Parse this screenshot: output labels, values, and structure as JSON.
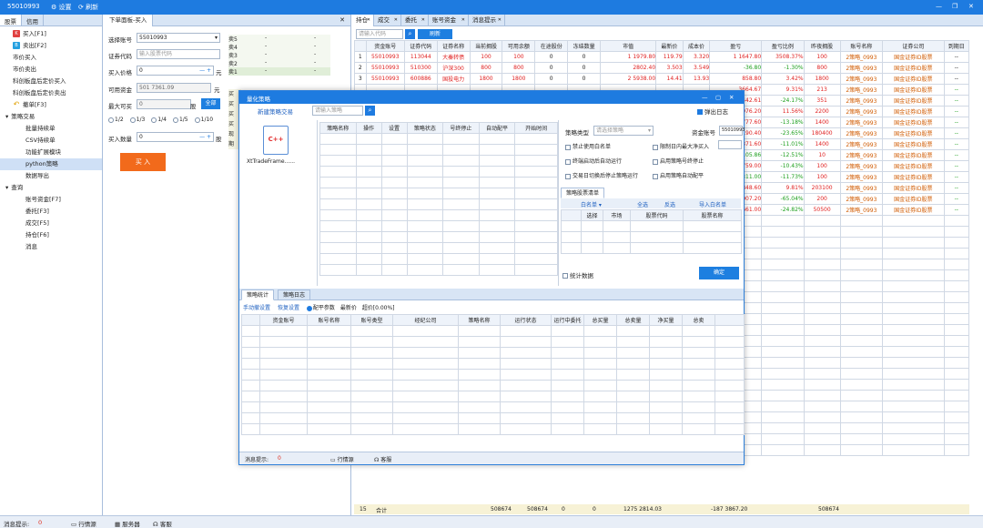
{
  "titlebar": {
    "account": "55010993",
    "settings": "设置",
    "refresh": "刷新"
  },
  "left_tabs": [
    "股票",
    "信用"
  ],
  "menu": [
    {
      "label": "买入[F1]",
      "icon": "K",
      "color": "#e04040",
      "indent": 14,
      "sel": false
    },
    {
      "label": "卖出[F2]",
      "icon": "B",
      "color": "#24a0e0",
      "indent": 14,
      "sel": false
    },
    {
      "label": "市价买入",
      "icon": "",
      "color": "",
      "indent": 14,
      "sel": false
    },
    {
      "label": "市价卖出",
      "icon": "",
      "color": "",
      "indent": 14,
      "sel": false
    },
    {
      "label": "科创板盘后定价买入",
      "icon": "",
      "color": "",
      "indent": 14,
      "sel": false
    },
    {
      "label": "科创板盘后定价卖出",
      "icon": "",
      "color": "",
      "indent": 14,
      "sel": false
    },
    {
      "label": "撤单[F3]",
      "icon": "↶",
      "color": "#e0a000",
      "indent": 14,
      "sel": false
    },
    {
      "label": "策略交易",
      "icon": "",
      "color": "",
      "indent": 6,
      "sel": false,
      "group": true
    },
    {
      "label": "批量持续单",
      "icon": "",
      "color": "",
      "indent": 28,
      "sel": false
    },
    {
      "label": "CSV持续单",
      "icon": "",
      "color": "",
      "indent": 28,
      "sel": false
    },
    {
      "label": "功能扩展模块",
      "icon": "",
      "color": "",
      "indent": 28,
      "sel": false
    },
    {
      "label": "python策略",
      "icon": "",
      "color": "",
      "indent": 28,
      "sel": true
    },
    {
      "label": "数据导出",
      "icon": "",
      "color": "",
      "indent": 28,
      "sel": false
    },
    {
      "label": "查询",
      "icon": "",
      "color": "",
      "indent": 6,
      "sel": false,
      "group": true
    },
    {
      "label": "账号资金[F7]",
      "icon": "",
      "color": "",
      "indent": 28,
      "sel": false
    },
    {
      "label": "委托[F3]",
      "icon": "",
      "color": "",
      "indent": 28,
      "sel": false
    },
    {
      "label": "成交[F5]",
      "icon": "",
      "color": "",
      "indent": 28,
      "sel": false
    },
    {
      "label": "持仓[F6]",
      "icon": "",
      "color": "",
      "indent": 28,
      "sel": false
    },
    {
      "label": "消息",
      "icon": "",
      "color": "",
      "indent": 28,
      "sel": false
    }
  ],
  "order": {
    "tab": "下单面板-买入",
    "account_label": "选择账号",
    "account": "55010993",
    "code_label": "证券代码",
    "code_ph": "输入股票代码",
    "price_label": "买入价格",
    "price": "0",
    "price_unit": "元",
    "avail_label": "可用资金",
    "avail": "501 7361.09",
    "avail_unit": "元",
    "max_label": "最大可买",
    "max": "0",
    "max_unit": "股",
    "all_btn": "全部",
    "fractions": [
      "1/2",
      "1/3",
      "1/4",
      "1/5",
      "1/10"
    ],
    "qty_label": "买入数量",
    "qty": "0",
    "qty_unit": "股",
    "buy_btn": "买 入",
    "sells": [
      "卖5",
      "卖4",
      "卖3",
      "卖2",
      "卖1"
    ],
    "dash": "-",
    "extra": [
      "买",
      "买",
      "买",
      "买",
      "现",
      "期"
    ]
  },
  "right_tabs": [
    "持仓",
    "成交",
    "委托",
    "账号资金",
    "消息提示"
  ],
  "search_ph": "请输入代码",
  "search_btn": "刷新",
  "pos_headers": [
    "",
    "资金账号",
    "证券代码",
    "证券名称",
    "当前拥股",
    "可用余额",
    "在途股份",
    "冻结数量",
    "市值",
    "最新价",
    "成本价",
    "盈亏",
    "盈亏比例",
    "昨夜拥股",
    "账号名称",
    "证券公司",
    "到期日"
  ],
  "pos_rows": [
    [
      "1",
      "55010993",
      "113044",
      "大秦转债",
      "100",
      "100",
      "0",
      "0",
      "1 1979.80",
      "119.79",
      "3.320",
      "1 1647.80",
      "3508.37%",
      "100",
      "2策略_0993",
      "国金证券ID股票",
      "--"
    ],
    [
      "2",
      "55010993",
      "510300",
      "沪深300",
      "800",
      "800",
      "0",
      "0",
      "2802.40",
      "3.503",
      "3.549",
      "-36.80",
      "-1.30%",
      "800",
      "2策略_0993",
      "国金证券ID股票",
      "--"
    ],
    [
      "3",
      "55010993",
      "600886",
      "国投电力",
      "1800",
      "1800",
      "0",
      "0",
      "2 5938.00",
      "14.41",
      "13.93",
      "858.80",
      "3.42%",
      "1800",
      "2策略_0993",
      "国金证券ID股票",
      "--"
    ]
  ],
  "pos_extra": [
    [
      "3664.67",
      "9.31%",
      "213"
    ],
    [
      "5442.61",
      "-24.17%",
      "351"
    ],
    [
      "8976.20",
      "11.56%",
      "2200"
    ],
    [
      "2777.60",
      "-13.18%",
      "1400"
    ],
    [
      "2190.40",
      "-23.65%",
      "180400"
    ],
    [
      "2371.60",
      "-11.01%",
      "1400"
    ],
    [
      "-105.86",
      "-12.51%",
      "10"
    ],
    [
      "1759.00",
      "-10.43%",
      "100"
    ],
    [
      "-311.00",
      "-11.73%",
      "100"
    ],
    [
      "5848.60",
      "9.81%",
      "203100"
    ],
    [
      "4007.20",
      "-65.04%",
      "200"
    ],
    [
      "7661.00",
      "-24.82%",
      "50500"
    ]
  ],
  "extra_name": "2策略_0993",
  "extra_broker": "国金证券ID股票",
  "extra_exp": "--",
  "totals": {
    "count": "15",
    "label": "合计",
    "hold": "508674",
    "avail": "508674",
    "z1": "0",
    "z2": "0",
    "mv": "1275 2814.03",
    "pnl": "-187 3867.20",
    "last": "508674"
  },
  "dialog": {
    "title": "量化策略",
    "new_btn": "新建策略交易",
    "search_ph": "请输入策略",
    "float_log": "弹出日志",
    "strategy_file": "XtTradeFrame......",
    "cpp": "C++",
    "list_headers": [
      "策略名称",
      "操作",
      "设置",
      "策略状态",
      "号终停止",
      "自动配平",
      "开始时间"
    ],
    "type_label": "策略类型",
    "type_ph": "请选择策略",
    "acct_label": "资金账号",
    "acct": "55010993",
    "opts": [
      [
        "禁止使用白名单",
        "限制日内最大净买入"
      ],
      [
        "终端启动后自动运行",
        "启用策略号终停止"
      ],
      [
        "交易日切换后停止策略运行",
        "启用策略自动配平"
      ]
    ],
    "watch_tab": "策略股票清单",
    "whitelist": "白名单",
    "select_all": "全选",
    "invert": "反选",
    "import": "导入白名单",
    "watch_headers": [
      "选择",
      "市场",
      "股票代码",
      "股票名称"
    ],
    "stat": "统计数据",
    "ok": "确定",
    "bottom_tabs": [
      "策略统计",
      "策略日志"
    ],
    "sub": {
      "a": "手动撤设置",
      "b": "恢复设置",
      "c": "配平参数",
      "d": "最新价",
      "e": "超价[0.00%]"
    },
    "stat_headers": [
      "资金账号",
      "账号名称",
      "账号类型",
      "经纪公司",
      "策略名称",
      "运行状态",
      "运行中委托",
      "总买量",
      "总卖量",
      "净买量",
      "总卖"
    ],
    "msg": "消息提示:",
    "msg_count": "0",
    "market": "行情源",
    "tech": "客服"
  },
  "status": {
    "msg": "消息提示:",
    "count": "0",
    "market": "行情源",
    "server": "服务器",
    "tech": "客服"
  }
}
